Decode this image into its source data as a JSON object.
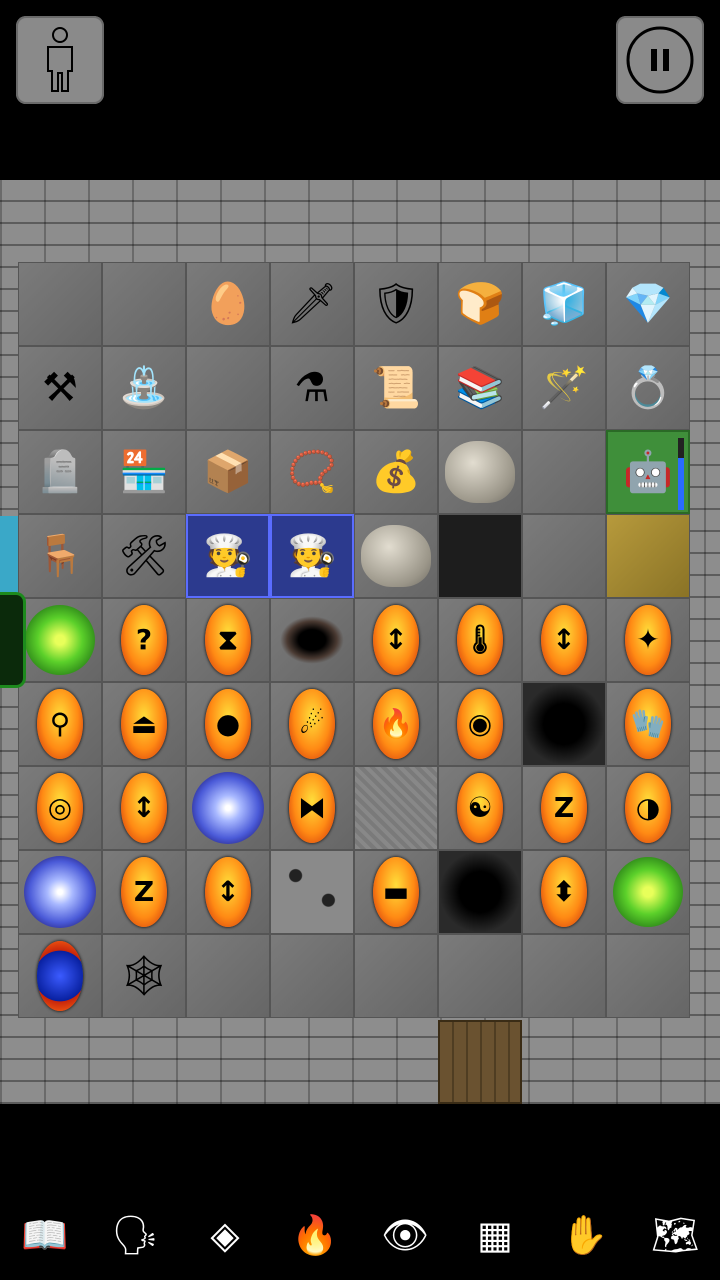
{
  "top": {
    "character_icon": "person-outline-icon",
    "pause_icon": "pause-icon"
  },
  "player": {
    "hp_fraction": 0.72
  },
  "vendor_label": "shopkeeper",
  "grid": [
    [
      {
        "type": "floor"
      },
      {
        "type": "floor"
      },
      {
        "type": "item",
        "icon": "🥚"
      },
      {
        "type": "item",
        "icon": "🗡"
      },
      {
        "type": "item",
        "icon": "🛡"
      },
      {
        "type": "item",
        "icon": "🍞"
      },
      {
        "type": "item",
        "icon": "🧊"
      },
      {
        "type": "item",
        "icon": "💎"
      }
    ],
    [
      {
        "type": "item",
        "icon": "⚒"
      },
      {
        "type": "item",
        "icon": "⛲"
      },
      {
        "type": "floor"
      },
      {
        "type": "item",
        "icon": "⚗"
      },
      {
        "type": "item",
        "icon": "📜"
      },
      {
        "type": "item",
        "icon": "📚"
      },
      {
        "type": "item",
        "icon": "🪄"
      },
      {
        "type": "item",
        "icon": "💍"
      }
    ],
    [
      {
        "type": "item",
        "icon": "🪦"
      },
      {
        "type": "item",
        "icon": "🏪"
      },
      {
        "type": "item",
        "icon": "📦"
      },
      {
        "type": "item",
        "icon": "📿"
      },
      {
        "type": "item",
        "icon": "💰"
      },
      {
        "type": "rock"
      },
      {
        "type": "floor"
      },
      {
        "type": "player",
        "icon": "🤖"
      }
    ],
    [
      {
        "type": "item",
        "icon": "🪑"
      },
      {
        "type": "item",
        "icon": "🛠"
      },
      {
        "type": "vendor",
        "icon": "🧑‍🍳"
      },
      {
        "type": "vendor",
        "icon": "🧑‍🍳"
      },
      {
        "type": "rock"
      },
      {
        "type": "dark"
      },
      {
        "type": "floor"
      },
      {
        "type": "sand"
      }
    ],
    [
      {
        "type": "swirl"
      },
      {
        "type": "oval",
        "glyph": "?"
      },
      {
        "type": "oval",
        "glyph": "⧗"
      },
      {
        "type": "hole"
      },
      {
        "type": "oval",
        "glyph": "↕"
      },
      {
        "type": "oval",
        "glyph": "🌡"
      },
      {
        "type": "oval",
        "glyph": "↕"
      },
      {
        "type": "oval",
        "glyph": "✦"
      }
    ],
    [
      {
        "type": "oval",
        "glyph": "⚲"
      },
      {
        "type": "oval",
        "glyph": "⏏"
      },
      {
        "type": "oval",
        "glyph": "●"
      },
      {
        "type": "oval",
        "glyph": "☄"
      },
      {
        "type": "oval",
        "glyph": "🔥"
      },
      {
        "type": "oval",
        "glyph": "◉"
      },
      {
        "type": "pit"
      },
      {
        "type": "oval",
        "glyph": "🧤"
      }
    ],
    [
      {
        "type": "oval",
        "glyph": "◎"
      },
      {
        "type": "oval",
        "glyph": "↕"
      },
      {
        "type": "orb"
      },
      {
        "type": "oval",
        "glyph": "⧓"
      },
      {
        "type": "stone"
      },
      {
        "type": "oval",
        "glyph": "☯"
      },
      {
        "type": "oval",
        "glyph": "Z"
      },
      {
        "type": "oval",
        "glyph": "◑"
      }
    ],
    [
      {
        "type": "orb"
      },
      {
        "type": "oval",
        "glyph": "Z"
      },
      {
        "type": "oval",
        "glyph": "↕"
      },
      {
        "type": "dots"
      },
      {
        "type": "oval",
        "glyph": "▬"
      },
      {
        "type": "pit"
      },
      {
        "type": "oval",
        "glyph": "⬍"
      },
      {
        "type": "swirl"
      }
    ],
    [
      {
        "type": "blueoval"
      },
      {
        "type": "item",
        "icon": "🕸"
      },
      {
        "type": "floor"
      },
      {
        "type": "floor"
      },
      {
        "type": "floor"
      },
      {
        "type": "floor"
      },
      {
        "type": "floor"
      },
      {
        "type": "floor"
      }
    ]
  ],
  "toolbar": [
    {
      "name": "journal-button",
      "icon": "📖"
    },
    {
      "name": "head-button",
      "icon": "🗣"
    },
    {
      "name": "spell-button",
      "icon": "◈"
    },
    {
      "name": "campfire-button",
      "icon": "🔥"
    },
    {
      "name": "look-button",
      "icon": "👁"
    },
    {
      "name": "floor-view-button",
      "icon": "▦"
    },
    {
      "name": "hand-button",
      "icon": "✋"
    },
    {
      "name": "map-button",
      "icon": "🗺"
    }
  ]
}
